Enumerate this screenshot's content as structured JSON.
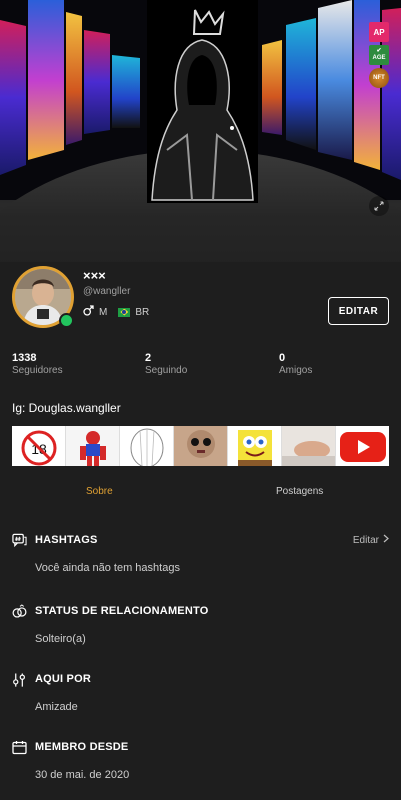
{
  "cover": {
    "badges": [
      "AP",
      "AGE",
      "NFT"
    ],
    "icons": [
      "expand-icon"
    ]
  },
  "profile": {
    "display_name": "×××",
    "handle": "@wangller",
    "gender": "M",
    "country": "BR",
    "edit_label": "EDITAR",
    "online": true
  },
  "stats": [
    {
      "value": "1338",
      "label": "Seguidores"
    },
    {
      "value": "2",
      "label": "Seguindo"
    },
    {
      "value": "0",
      "label": "Amigos"
    }
  ],
  "bio": "Ig: Douglas.wangller",
  "gallery_count": 7,
  "tabs": [
    {
      "label": "Sobre",
      "active": true
    },
    {
      "label": "Postagens",
      "active": false
    }
  ],
  "sections": {
    "hashtags": {
      "title": "HASHTAGS",
      "action": "Editar",
      "value": "Você ainda não tem hashtags"
    },
    "relationship": {
      "title": "STATUS DE RELACIONAMENTO",
      "value": "Solteiro(a)"
    },
    "here_for": {
      "title": "AQUI POR",
      "value": "Amizade"
    },
    "member_since": {
      "title": "MEMBRO DESDE",
      "value": "30 de mai. de 2020"
    }
  },
  "colors": {
    "accent": "#e0a133",
    "background": "#1e1e1e",
    "online": "#22c55e",
    "ap_badge": "#e3296b",
    "age_badge": "#2e8b3e"
  }
}
